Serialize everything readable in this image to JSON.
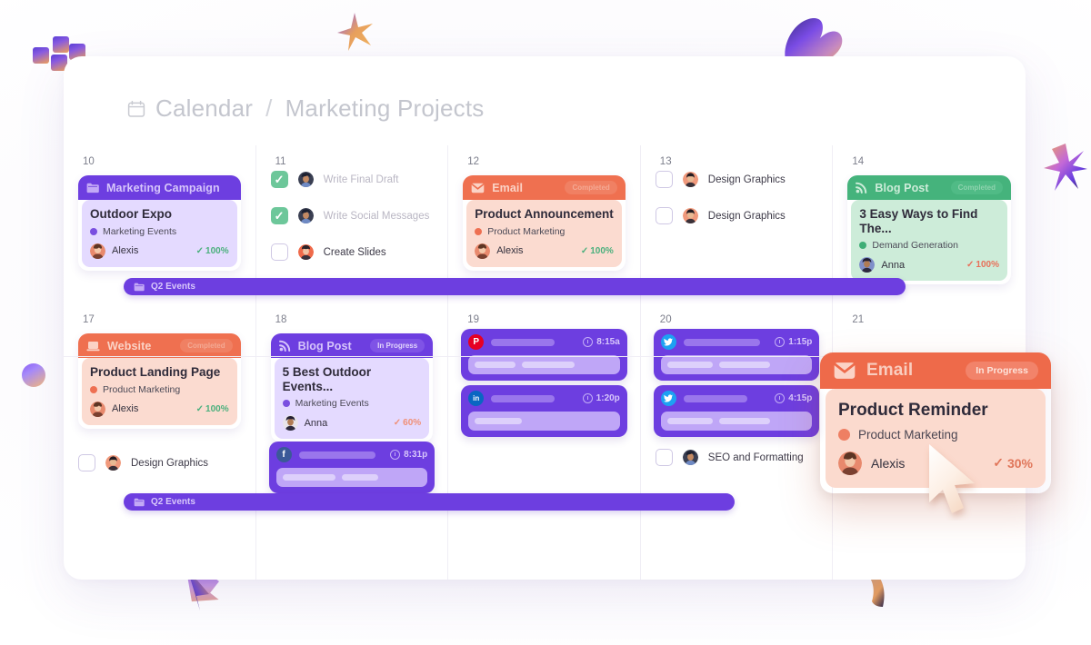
{
  "header": {
    "calendar_label": "Calendar",
    "separator": "/",
    "project_label": "Marketing Projects",
    "calendar_icon": "calendar-icon"
  },
  "week1": {
    "days": [
      "10",
      "11",
      "12",
      "13",
      "14"
    ],
    "event_bar": {
      "label": "Q2 Events",
      "icon": "folder-icon"
    },
    "day10": {
      "card": {
        "type": "Marketing Campaign",
        "type_icon": "folder-icon",
        "title": "Outdoor Expo",
        "tag": "Marketing Events",
        "tag_color": "#7a4fe0",
        "assignee": "Alexis",
        "progress": "100%",
        "check": "✓",
        "theme": "purple"
      }
    },
    "day11": {
      "tasks": [
        {
          "label": "Write Final Draft",
          "checked": true
        },
        {
          "label": "Write Social Messages",
          "checked": true
        },
        {
          "label": "Create Slides",
          "checked": false
        }
      ]
    },
    "day12": {
      "card": {
        "type": "Email",
        "type_icon": "envelope-icon",
        "badge": "Completed",
        "title": "Product Announcement",
        "tag": "Product Marketing",
        "tag_color": "#ee7052",
        "assignee": "Alexis",
        "progress": "100%",
        "check": "✓",
        "theme": "orange"
      }
    },
    "day13": {
      "tasks": [
        {
          "label": "Design Graphics",
          "checked": false
        },
        {
          "label": "Design Graphics",
          "checked": false
        }
      ]
    },
    "day14": {
      "card": {
        "type": "Blog Post",
        "type_icon": "rss-icon",
        "badge": "Completed",
        "title": "3 Easy Ways to Find The...",
        "tag": "Demand Generation",
        "tag_color": "#3fae76",
        "assignee": "Anna",
        "progress": "100%",
        "check": "✓",
        "theme": "green"
      }
    }
  },
  "week2": {
    "days": [
      "17",
      "18",
      "19",
      "20",
      "21"
    ],
    "event_bar": {
      "label": "Q2 Events",
      "icon": "folder-icon"
    },
    "day17": {
      "card": {
        "type": "Website",
        "type_icon": "laptop-icon",
        "badge": "Completed",
        "title": "Product Landing Page",
        "tag": "Product Marketing",
        "tag_color": "#ee7052",
        "assignee": "Alexis",
        "progress": "100%",
        "check": "✓",
        "theme": "orange"
      },
      "task": {
        "label": "Design Graphics",
        "checked": false
      }
    },
    "day18": {
      "card": {
        "type": "Blog Post",
        "type_icon": "rss-icon",
        "badge": "In Progress",
        "title": "5 Best Outdoor Events...",
        "tag": "Marketing Events",
        "tag_color": "#7a4fe0",
        "assignee": "Anna",
        "progress": "60%",
        "check": "✓",
        "theme": "purple"
      },
      "social": {
        "network": "facebook",
        "glyph": "f",
        "color": "#3b5998",
        "time": "8:31p"
      }
    },
    "day19": {
      "social": [
        {
          "network": "pinterest",
          "glyph": "P",
          "color": "#e60023",
          "time": "8:15a"
        },
        {
          "network": "linkedin",
          "glyph": "in",
          "color": "#0a66c2",
          "time": "1:20p"
        }
      ]
    },
    "day20": {
      "social": [
        {
          "network": "twitter",
          "glyph": "t",
          "color": "#1da1f2",
          "time": "1:15p"
        },
        {
          "network": "twitter",
          "glyph": "t",
          "color": "#1da1f2",
          "time": "4:15p"
        }
      ],
      "task": {
        "label": "SEO and Formatting",
        "checked": false
      }
    }
  },
  "floating_card": {
    "type": "Email",
    "type_icon": "envelope-icon",
    "badge": "In Progress",
    "title": "Product Reminder",
    "tag": "Product Marketing",
    "tag_color": "#ee7f63",
    "assignee": "Alexis",
    "progress": "30%",
    "check": "✓"
  },
  "colors": {
    "purple": "#6d3ee0",
    "orange": "#ef7050",
    "green": "#45b37c",
    "muted": "#c4c6ce"
  }
}
